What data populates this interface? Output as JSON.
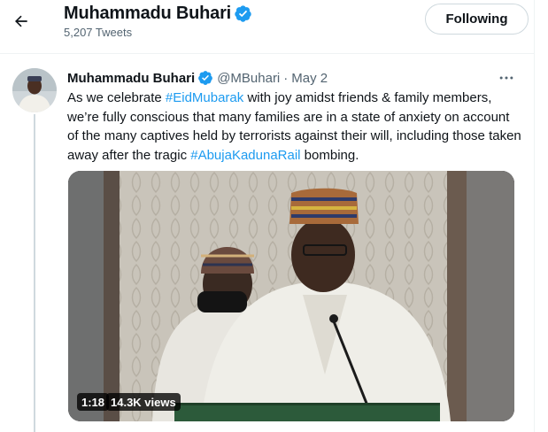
{
  "header": {
    "name": "Muhammadu Buhari",
    "tweet_count": "5,207 Tweets",
    "follow_label": "Following"
  },
  "tweet": {
    "author_name": "Muhammadu Buhari",
    "handle": "@MBuhari",
    "separator": "·",
    "date": "May 2",
    "text_parts": {
      "p1": "As we celebrate ",
      "tag1": "#EidMubarak",
      "p2": " with joy amidst friends & family members, we’re fully conscious that many families are in a state of anxiety on account of the many captives held by terrorists against their will, including those taken away after the tragic ",
      "tag2": "#AbujaKadunaRail",
      "p3": " bombing."
    }
  },
  "video": {
    "duration": "1:18",
    "views": "14.3K views"
  },
  "colors": {
    "accent": "#1d9bf0",
    "text_primary": "#0f1419",
    "text_secondary": "#536471"
  },
  "icons": {
    "back": "arrow-left-icon",
    "verified": "verified-badge-icon",
    "more": "more-horizontal-icon"
  }
}
